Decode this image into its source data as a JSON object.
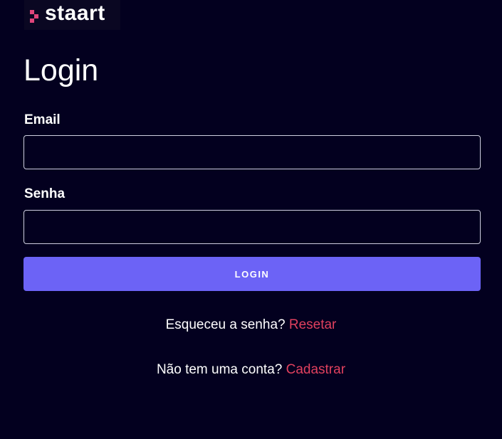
{
  "logo": {
    "text": "staart"
  },
  "page": {
    "title": "Login"
  },
  "form": {
    "email": {
      "label": "Email",
      "value": "",
      "placeholder": ""
    },
    "password": {
      "label": "Senha",
      "value": "",
      "placeholder": ""
    },
    "submit_label": "LOGIN"
  },
  "links": {
    "reset_prompt": "Esqueceu a senha?",
    "reset_label": "Resetar",
    "signup_prompt": "Não tem uma conta?",
    "signup_label": "Cadastrar"
  },
  "colors": {
    "background": "#03001f",
    "button": "#6c63f6",
    "link": "#e0405e",
    "logo_mark": "#e0457b"
  }
}
